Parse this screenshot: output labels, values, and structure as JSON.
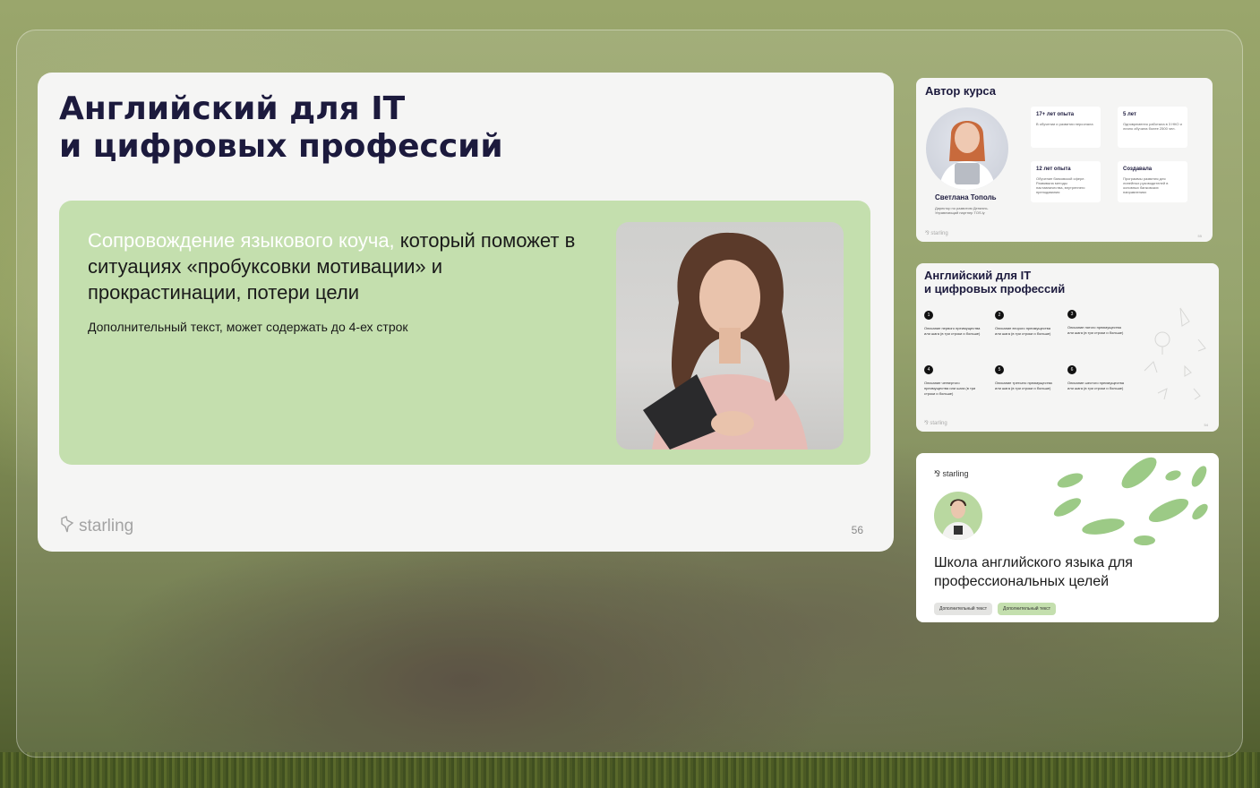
{
  "main_slide": {
    "title": "Английский для IT\nи цифровых профессий",
    "lead_accent": "Сопровождение языкового коуча,",
    "lead_rest": " который поможет в ситуациях «пробуксовки мотивации» и прокрастинации, потери цели",
    "subtext": "Дополнительный текст, может содержать до 4-ех строк",
    "logo_text": "starling",
    "page_number": "56"
  },
  "thumb_author": {
    "title": "Автор курса",
    "name": "Светлана Тополь",
    "role": "Директор по развитию Дениэль. Управляющий партнер TOS.ly",
    "stats": [
      {
        "head": "17+ лет опыта",
        "body": "В обучении и развитии персонала"
      },
      {
        "head": "5 лет",
        "body": "Одновременно работала в 3 НКО и лично обучила более 2500 чел."
      },
      {
        "head": "12 лет опыта",
        "body": "Обучение банковской сфере. Развивала методы наставничества, внутреннего преподавания"
      },
      {
        "head": "Создавала",
        "body": "Программы развития для линейных руководителей в основных банковских направлениях"
      }
    ],
    "logo_text": "starling",
    "page_number": "55"
  },
  "thumb_steps": {
    "title": "Английский для IT\nи цифровых профессий",
    "steps": [
      {
        "num": "1",
        "text": "Описание первого преимущества или шага (в три строки и больше)"
      },
      {
        "num": "2",
        "text": "Описание второго преимущества или шага (в три строки и больше)"
      },
      {
        "num": "3",
        "text": "Описание пятого преимущества или шага (в три строки и больше)"
      },
      {
        "num": "4",
        "text": "Описание четвертого преимущества или шага (в три строки и больше)"
      },
      {
        "num": "5",
        "text": "Описание третьего преимущества или шага (в три строки и больше)"
      },
      {
        "num": "6",
        "text": "Описание шестого преимущества или шага (в три строки и больше)"
      }
    ],
    "logo_text": "starling",
    "page_number": "54"
  },
  "thumb_school": {
    "logo_text": "starling",
    "title": "Школа английского языка для профессиональных целей",
    "chip_1": "Дополнительный текст",
    "chip_2": "Дополнительный текст"
  },
  "colors": {
    "accent_green": "#c4dfae",
    "title_navy": "#1c1a3d",
    "leaf_green": "#9cca86"
  }
}
